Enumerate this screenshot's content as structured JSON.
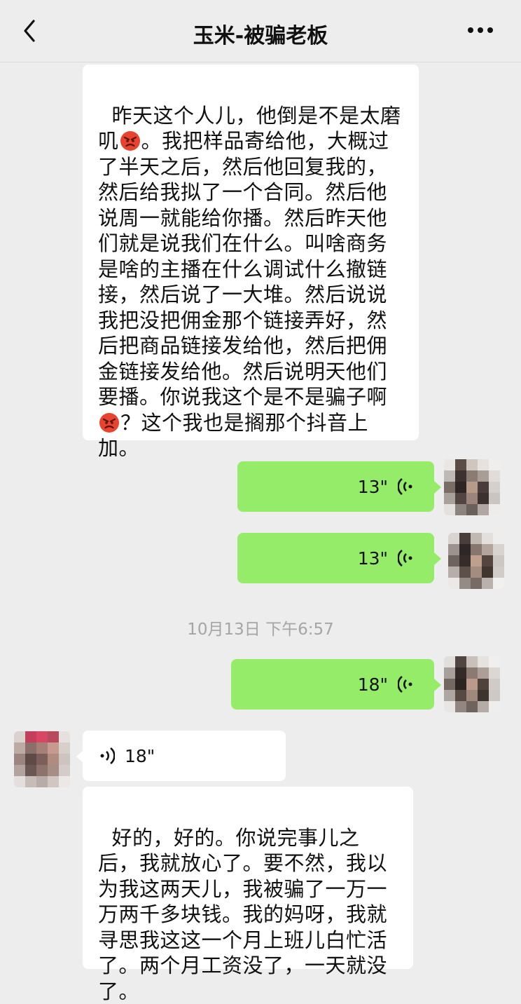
{
  "header": {
    "title": "玉米-被骗老板",
    "back_icon": "chevron-left-icon",
    "more_icon": "more-dots-icon"
  },
  "messages": {
    "m1": {
      "p1": "昨天这个人儿，他倒是不是太磨叽",
      "p2": "。我把样品寄给他，大概过了半天之后，然后他回复我的，然后给我拟了一个合同。然后他说周一就能给你播。然后昨天他们就是说我们在什么。叫啥商务是啥的主播在什么调试什么撤链接，然后说了一大堆。然后说说我把没把佣金那个链接弄好，然后把商品链接发给他，然后把佣金链接发给他。然后说明天他们要播。你说我这个是不是骗子啊",
      "p3": "？这个我也是搁那个抖音上加。",
      "emoji": "angry-face-emoji"
    },
    "voice1": {
      "length": "13\""
    },
    "voice2": {
      "length": "13\""
    },
    "timestamp": "10月13日 下午6:57",
    "voice3": {
      "length": "18\""
    },
    "voice4": {
      "length": "18\""
    },
    "m2": {
      "text": "好的，好的。你说完事儿之后，我就放心了。要不然，我以为我这两天儿，我被骗了一万一万两千多块钱。我的妈呀，我就寻思我这这一个月上班儿白忙活了。两个月工资没了，一天就没了。"
    }
  },
  "colors": {
    "background": "#ededed",
    "outgoing_bubble": "#95ec69",
    "incoming_bubble": "#ffffff",
    "timestamp_text": "#a5a5a5"
  }
}
